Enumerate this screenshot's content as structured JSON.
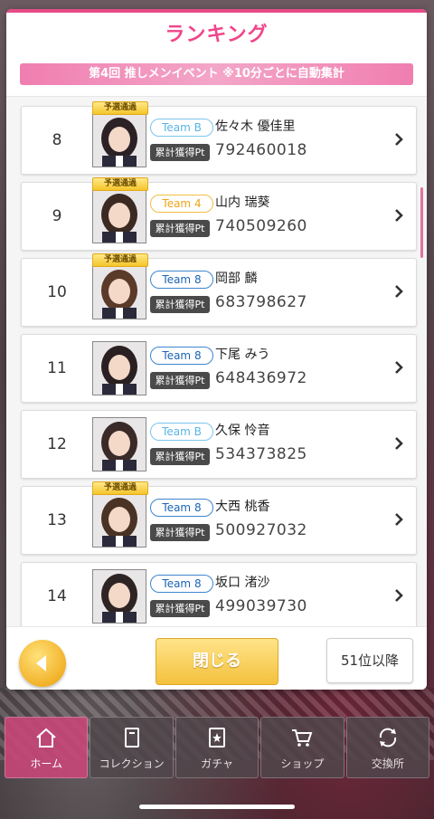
{
  "modal": {
    "title": "ランキング",
    "event_banner": "第4回 推しメンイベント ※10分ごとに自動集計",
    "qualified_badge": "予選通過",
    "points_label": "累計獲得Pt",
    "close_label": "閉じる",
    "next_page_label": "51位以降"
  },
  "ranking": [
    {
      "rank": "8",
      "team": "Team B",
      "team_style": "teamb",
      "name": "佐々木 優佳里",
      "points": "792460018",
      "qualified": true
    },
    {
      "rank": "9",
      "team": "Team 4",
      "team_style": "team4",
      "name": "山内 瑞葵",
      "points": "740509260",
      "qualified": true
    },
    {
      "rank": "10",
      "team": "Team 8",
      "team_style": "team8",
      "name": "岡部 麟",
      "points": "683798627",
      "qualified": true
    },
    {
      "rank": "11",
      "team": "Team 8",
      "team_style": "team8",
      "name": "下尾 みう",
      "points": "648436972",
      "qualified": false
    },
    {
      "rank": "12",
      "team": "Team B",
      "team_style": "teamb",
      "name": "久保 怜音",
      "points": "534373825",
      "qualified": false
    },
    {
      "rank": "13",
      "team": "Team 8",
      "team_style": "team8",
      "name": "大西 桃香",
      "points": "500927032",
      "qualified": true
    },
    {
      "rank": "14",
      "team": "Team 8",
      "team_style": "team8",
      "name": "坂口 渚沙",
      "points": "499039730",
      "qualified": false
    }
  ],
  "nav": [
    {
      "label": "ホーム",
      "icon": "home-icon",
      "active": true
    },
    {
      "label": "コレクション",
      "icon": "collection-icon",
      "active": false
    },
    {
      "label": "ガチャ",
      "icon": "gacha-icon",
      "active": false
    },
    {
      "label": "ショップ",
      "icon": "cart-icon",
      "active": false
    },
    {
      "label": "交換所",
      "icon": "exchange-icon",
      "active": false
    }
  ],
  "colors": {
    "accent_pink": "#f0468a",
    "gold": "#f3c13d"
  }
}
